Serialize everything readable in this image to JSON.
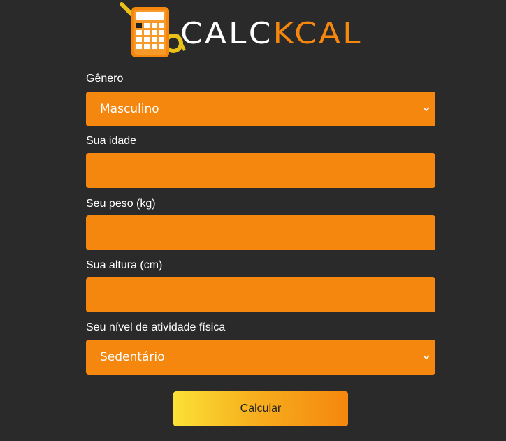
{
  "logo": {
    "icon": "calculator-with-measuring-tape-icon",
    "text_part1": "CALC",
    "text_part2": "KCAL",
    "brand_white": "#ffffff",
    "brand_orange": "#f5870e"
  },
  "form": {
    "gender": {
      "label": "Gênero",
      "value": "Masculino"
    },
    "age": {
      "label": "Sua idade",
      "value": ""
    },
    "weight": {
      "label": "Seu peso (kg)",
      "value": ""
    },
    "height": {
      "label": "Sua altura (cm)",
      "value": ""
    },
    "activity": {
      "label": "Seu nível de atividade física",
      "value": "Sedentário"
    },
    "submit_label": "Calcular"
  },
  "colors": {
    "background": "#2a2a2a",
    "field": "#f5870e",
    "button_gradient_start": "#fbe136",
    "button_gradient_end": "#f5870e"
  }
}
